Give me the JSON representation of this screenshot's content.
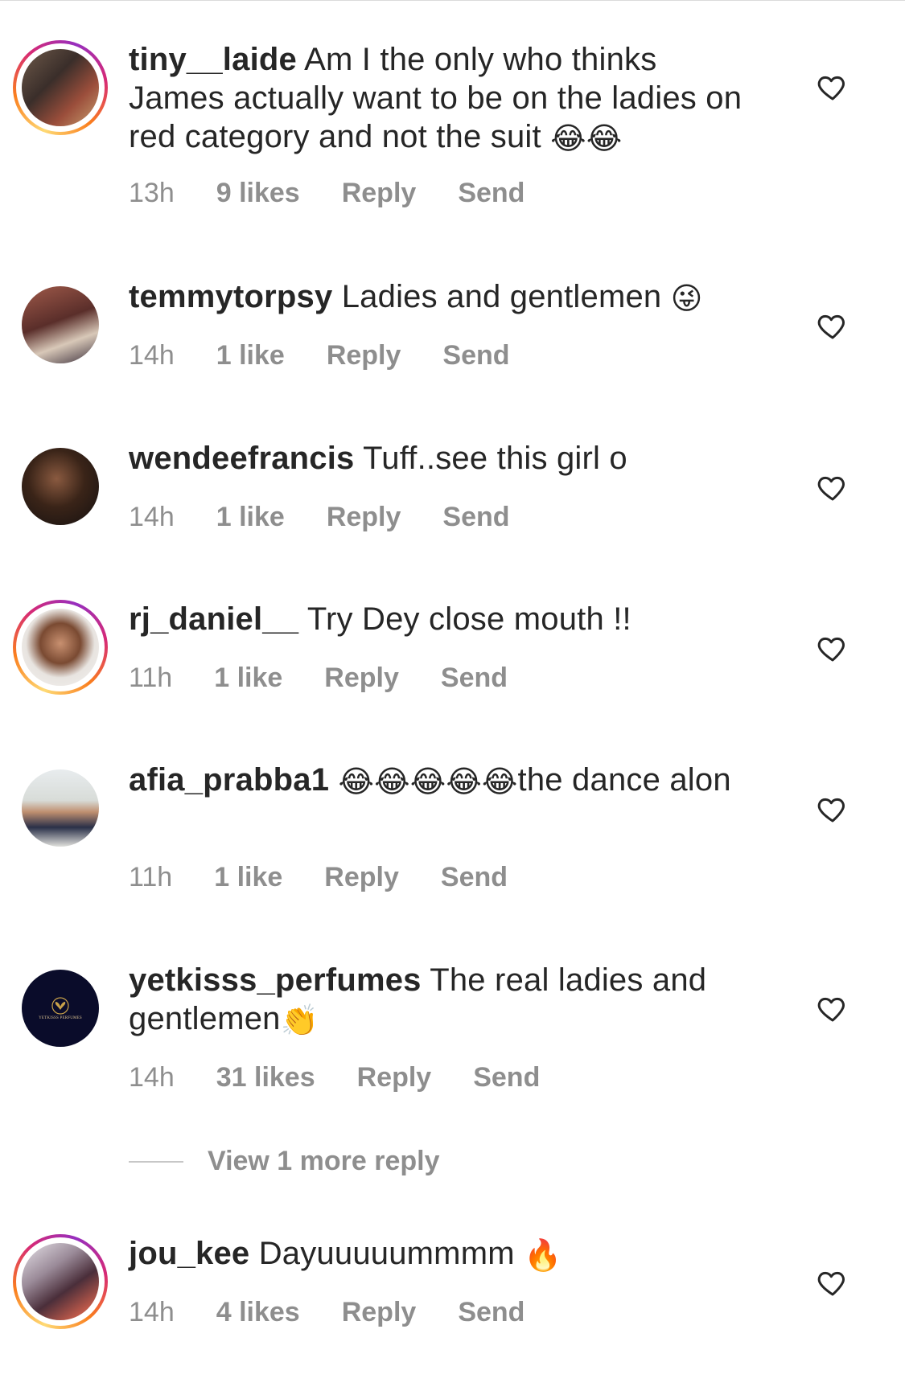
{
  "comments": [
    {
      "username": "tiny__laide",
      "text": "Am I the only who thinks James actually want to be on the ladies on red category and not the suit",
      "emoji": "😂😂",
      "time": "13h",
      "likes": "9 likes",
      "reply": "Reply",
      "send": "Send",
      "story_ring": true
    },
    {
      "username": "temmytorpsy",
      "text": "Ladies and gentlemen",
      "emoji": "😜",
      "time": "14h",
      "likes": "1 like",
      "reply": "Reply",
      "send": "Send",
      "story_ring": false
    },
    {
      "username": "wendeefrancis",
      "text": "Tuff..see this girl o",
      "emoji": "",
      "time": "14h",
      "likes": "1 like",
      "reply": "Reply",
      "send": "Send",
      "story_ring": false
    },
    {
      "username": "rj_daniel__",
      "text": "Try Dey close mouth !!",
      "emoji": "",
      "time": "11h",
      "likes": "1 like",
      "reply": "Reply",
      "send": "Send",
      "story_ring": true
    },
    {
      "username": "afia_prabba1",
      "emoji": "😂😂😂😂😂",
      "text": "the dance alon",
      "time": "11h",
      "likes": "1 like",
      "reply": "Reply",
      "send": "Send",
      "story_ring": false
    },
    {
      "username": "yetkisss_perfumes",
      "text": "The real ladies and gentlemen",
      "emoji": "👏",
      "time": "14h",
      "likes": "31 likes",
      "reply": "Reply",
      "send": "Send",
      "story_ring": false,
      "avatar_logo_text": "YETKISSS PERFUMES"
    },
    {
      "username": "jou_kee",
      "text": "Dayuuuuummmm",
      "emoji": "🔥",
      "time": "14h",
      "likes": "4 likes",
      "reply": "Reply",
      "send": "Send",
      "story_ring": true
    }
  ],
  "view_more_replies": "View 1 more reply",
  "icons": {
    "like": "heart-outline-icon"
  },
  "colors": {
    "text_primary": "#262626",
    "text_secondary": "#8e8e8e",
    "divider": "#dbdbdb"
  }
}
